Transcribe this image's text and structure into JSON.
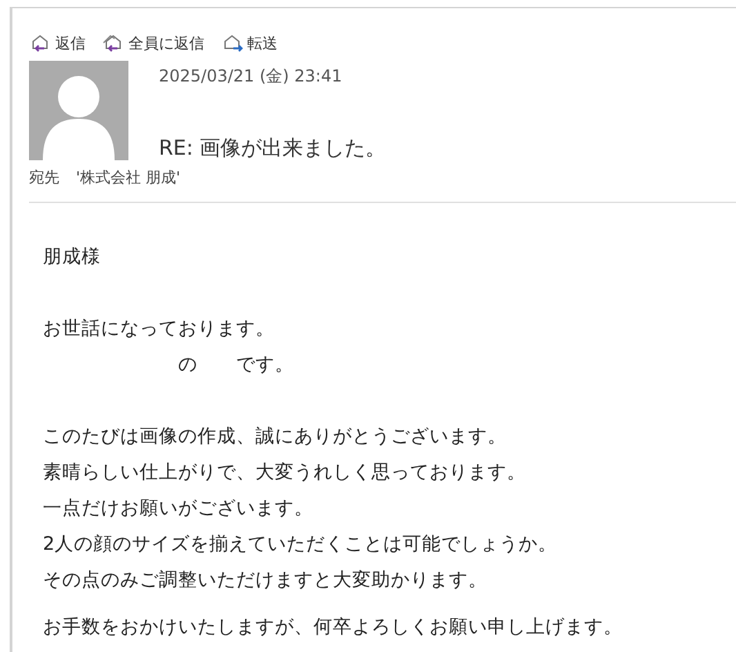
{
  "toolbar": [
    {
      "kind": "reply",
      "label": "返信"
    },
    {
      "kind": "reply_all",
      "label": "全員に返信"
    },
    {
      "kind": "forward",
      "label": "転送"
    }
  ],
  "message": {
    "date": "2025/03/21 (金) 23:41",
    "subject": "RE: 画像が出来ました。",
    "to_label": "宛先",
    "to": "'株式会社 朋成'"
  },
  "body": [
    [
      "朋成様"
    ],
    [
      "お世話になっております。",
      "　　　　　　　の　　です。"
    ],
    [
      "このたびは画像の作成、誠にありがとうございます。",
      "素晴らしい仕上がりで、大変うれしく思っております。",
      "一点だけお願いがございます。",
      "2人の顔のサイズを揃えていただくことは可能でしょうか。",
      "その点のみご調整いただけますと大変助かります。"
    ],
    [
      "お手数をおかけいたしますが、何卒よろしくお願い申し上げます。"
    ]
  ]
}
